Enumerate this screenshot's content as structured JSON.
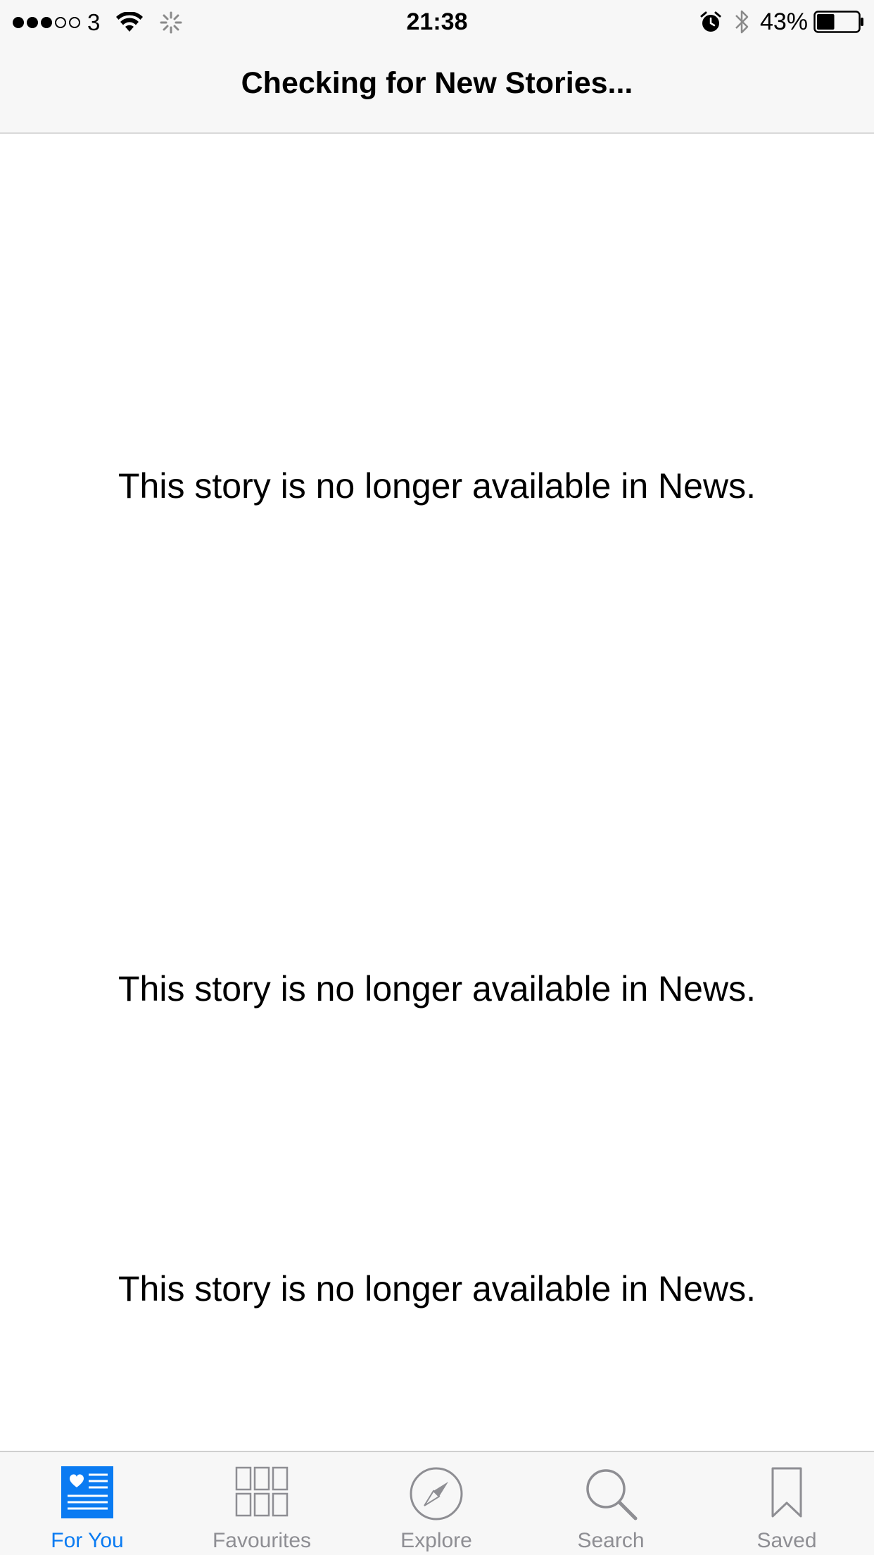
{
  "status_bar": {
    "carrier": "3",
    "signal_strength": 3,
    "signal_max": 5,
    "time": "21:38",
    "battery_percent_label": "43%",
    "battery_level": 0.43,
    "icons": [
      "signal-dots-icon",
      "wifi-icon",
      "activity-spinner-icon",
      "alarm-icon",
      "bluetooth-icon",
      "battery-icon"
    ]
  },
  "nav": {
    "title": "Checking for New Stories..."
  },
  "stories": [
    {
      "message": "This story is no longer available in News."
    },
    {
      "message": "This story is no longer available in News."
    },
    {
      "message": "This story is no longer available in News."
    }
  ],
  "tab_bar": {
    "accent_color": "#0a7bf2",
    "inactive_color": "#8e8e93",
    "tabs": [
      {
        "label": "For You",
        "icon": "for-you-icon",
        "active": true
      },
      {
        "label": "Favourites",
        "icon": "favourites-grid-icon",
        "active": false
      },
      {
        "label": "Explore",
        "icon": "compass-icon",
        "active": false
      },
      {
        "label": "Search",
        "icon": "search-icon",
        "active": false
      },
      {
        "label": "Saved",
        "icon": "bookmark-icon",
        "active": false
      }
    ]
  }
}
